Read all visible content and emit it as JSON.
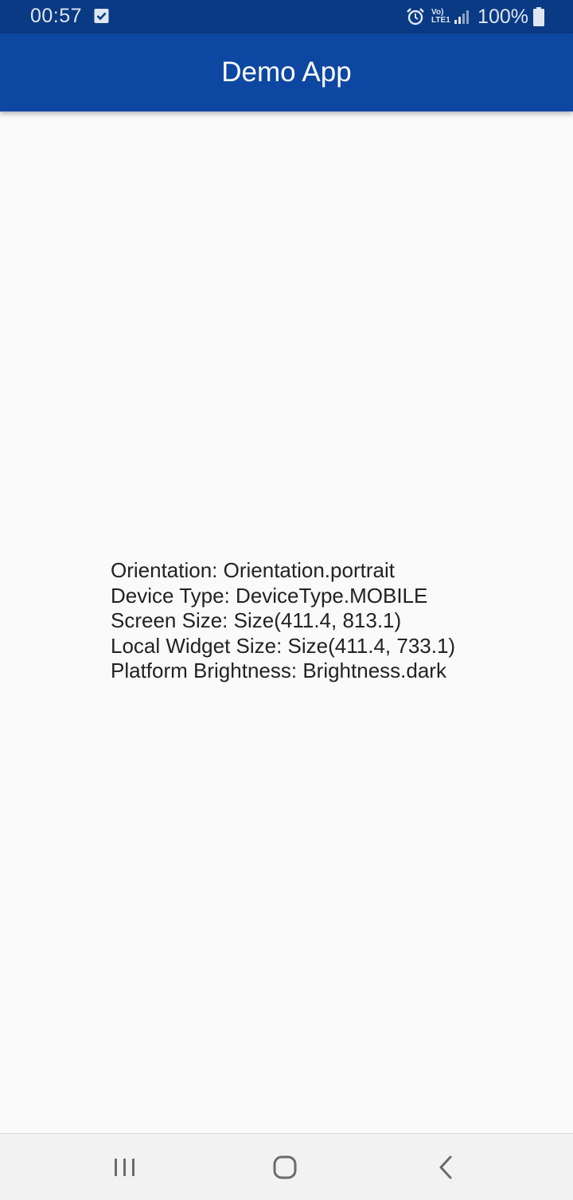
{
  "status_bar": {
    "time": "00:57",
    "network": "Vo) LTE1",
    "battery": "100%",
    "icons": [
      "check-box-icon",
      "alarm-icon",
      "signal-icon",
      "battery-icon"
    ]
  },
  "app_bar": {
    "title": "Demo App",
    "background_color": "#0d47a1"
  },
  "info": {
    "orientation": "Orientation: Orientation.portrait",
    "device_type": "Device Type: DeviceType.MOBILE",
    "screen_size": "Screen Size: Size(411.4, 813.1)",
    "local_widget_size": "Local Widget Size: Size(411.4, 733.1)",
    "platform_brightness": "Platform Brightness: Brightness.dark"
  },
  "nav_bar": {
    "buttons": [
      "recent-apps-icon",
      "home-icon",
      "back-icon"
    ]
  }
}
